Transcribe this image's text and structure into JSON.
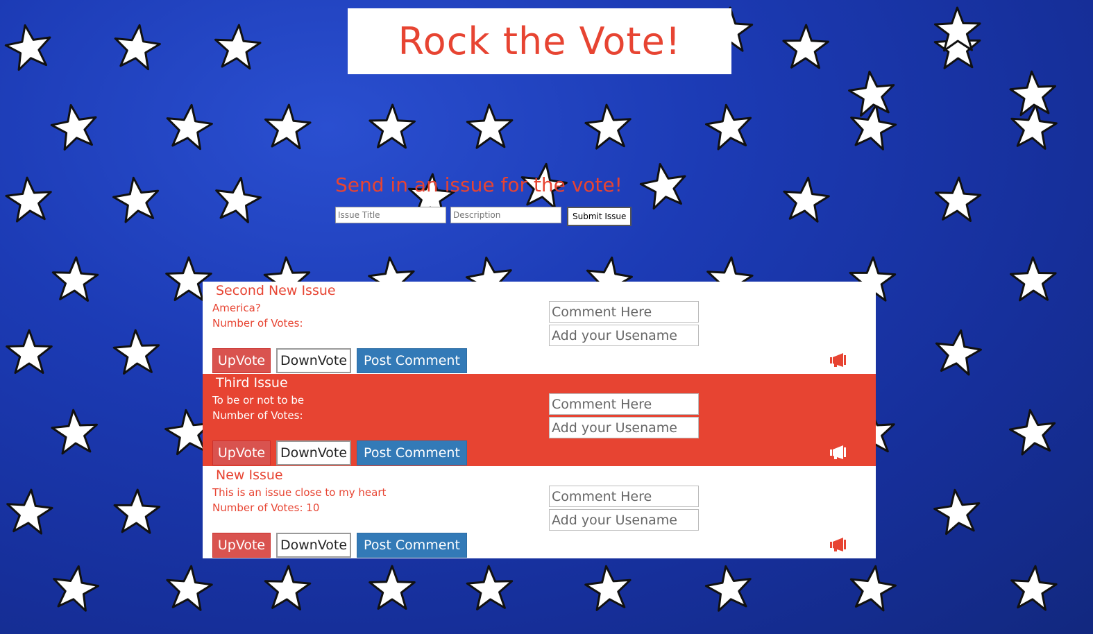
{
  "header": {
    "title": "Rock the Vote!"
  },
  "submit_form": {
    "heading": "Send in an issue for the vote!",
    "title_placeholder": "Issue Title",
    "description_placeholder": "Description",
    "submit_label": "Submit Issue"
  },
  "issues": [
    {
      "title": "Second New Issue",
      "description": "America?",
      "votes_label": "Number of Votes:",
      "comment_placeholder": "Comment Here",
      "username_placeholder": "Add your Usename",
      "upvote_label": "UpVote",
      "downvote_label": "DownVote",
      "post_label": "Post Comment",
      "icon": "megaphone-icon"
    },
    {
      "title": "Third Issue",
      "description": "To be or not to be",
      "votes_label": "Number of Votes:",
      "comment_placeholder": "Comment Here",
      "username_placeholder": "Add your Usename",
      "upvote_label": "UpVote",
      "downvote_label": "DownVote",
      "post_label": "Post Comment",
      "icon": "megaphone-icon"
    },
    {
      "title": "New Issue",
      "description": "This is an issue close to my heart",
      "votes_label": "Number of Votes: 10",
      "comment_placeholder": "Comment Here",
      "username_placeholder": "Add your Usename",
      "upvote_label": "UpVote",
      "downvote_label": "DownVote",
      "post_label": "Post Comment",
      "icon": "megaphone-icon"
    }
  ],
  "colors": {
    "accent_red": "#e74432",
    "background_blue": "#1c3bb5",
    "upvote": "#d9534f",
    "post_comment": "#337ab7"
  }
}
